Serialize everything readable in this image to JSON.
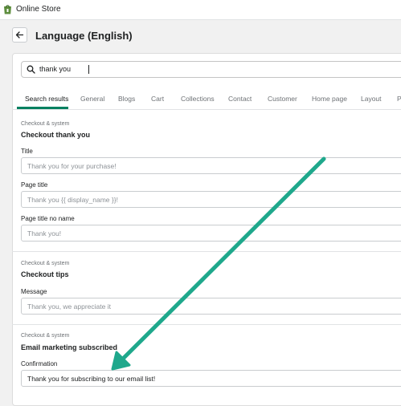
{
  "app": {
    "title": "Online Store"
  },
  "header": {
    "title": "Language (English)"
  },
  "search": {
    "value": "thank you"
  },
  "tabs": [
    {
      "label": "Search results"
    },
    {
      "label": "General"
    },
    {
      "label": "Blogs"
    },
    {
      "label": "Cart"
    },
    {
      "label": "Collections"
    },
    {
      "label": "Contact"
    },
    {
      "label": "Customer"
    },
    {
      "label": "Home page"
    },
    {
      "label": "Layout"
    },
    {
      "label": "P"
    }
  ],
  "sections": [
    {
      "category": "Checkout & system",
      "title": "Checkout thank you",
      "fields": [
        {
          "label": "Title",
          "placeholder": "Thank you for your purchase!"
        },
        {
          "label": "Page title",
          "placeholder": "Thank you {{ display_name }}!"
        },
        {
          "label": "Page title no name",
          "placeholder": "Thank you!"
        }
      ]
    },
    {
      "category": "Checkout & system",
      "title": "Checkout tips",
      "fields": [
        {
          "label": "Message",
          "placeholder": "Thank you, we appreciate it"
        }
      ]
    },
    {
      "category": "Checkout & system",
      "title": "Email marketing subscribed",
      "fields": [
        {
          "label": "Confirmation",
          "value": "Thank you for subscribing to our email list!"
        }
      ]
    }
  ],
  "colors": {
    "accent": "#008060",
    "annotation_arrow": "#1fa88c"
  },
  "icons": {
    "logo": "shopify-bag-icon",
    "back": "arrow-left-icon",
    "search": "search-icon"
  }
}
